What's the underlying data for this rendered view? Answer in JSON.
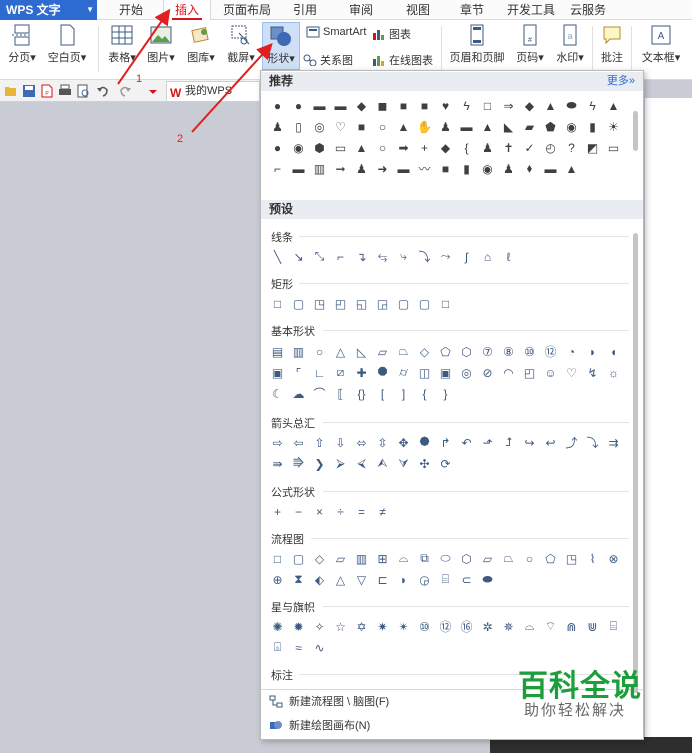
{
  "menubar": {
    "app_name": "WPS 文字",
    "tabs": [
      "开始",
      "插入",
      "页面布局",
      "引用",
      "审阅",
      "视图",
      "章节",
      "开发工具",
      "云服务"
    ],
    "active_tab": "插入"
  },
  "ribbon": {
    "buttons": [
      "分页",
      "空白页",
      "表格",
      "图片",
      "图库",
      "截屏",
      "形状",
      "页眉和页脚",
      "页码",
      "水印",
      "批注",
      "文本框"
    ],
    "small": [
      "SmartArt",
      "图表",
      "关系图",
      "在线图表"
    ]
  },
  "document_tab": {
    "label": "我的WPS",
    "close": "×"
  },
  "annotations": {
    "step1": "1",
    "step2": "2"
  },
  "shapes_panel": {
    "recommended_header": "推荐",
    "more_link": "更多»",
    "preset_header": "预设",
    "groups": [
      {
        "title": "线条"
      },
      {
        "title": "矩形"
      },
      {
        "title": "基本形状"
      },
      {
        "title": "箭头总汇"
      },
      {
        "title": "公式形状"
      },
      {
        "title": "流程图"
      },
      {
        "title": "星与旗帜"
      },
      {
        "title": "标注"
      }
    ],
    "footer": [
      "新建流程图 \\ 脑图(F)",
      "新建绘图画布(N)"
    ]
  },
  "watermark": {
    "main": "百科全说",
    "sub": "助你轻松解决"
  },
  "colors": {
    "accent_red": "#d6121c",
    "app_blue": "#2e6bd1",
    "shape_blue": "#3d5a80",
    "watermark_green": "#1c9e3a"
  }
}
